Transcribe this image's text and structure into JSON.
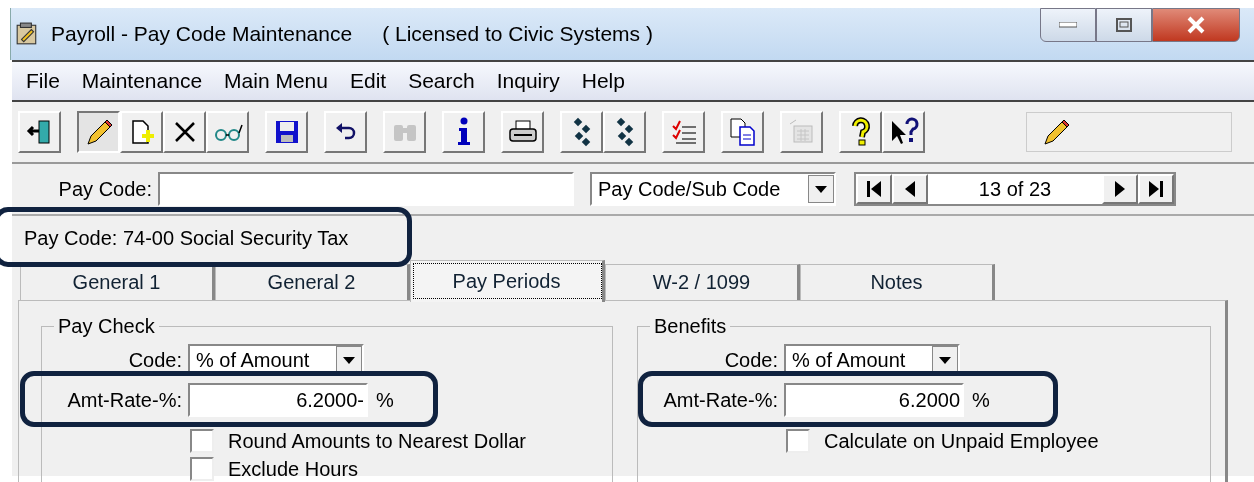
{
  "window": {
    "title": "Payroll - Pay Code Maintenance",
    "license": "( Licensed to Civic Systems )"
  },
  "menu": [
    "File",
    "Maintenance",
    "Main Menu",
    "Edit",
    "Search",
    "Inquiry",
    "Help"
  ],
  "toolbar": [
    [
      {
        "kind": "exit",
        "pressed": false,
        "disabled": false
      }
    ],
    [
      {
        "kind": "edit",
        "pressed": true,
        "disabled": false
      },
      {
        "kind": "new",
        "pressed": false,
        "disabled": false
      },
      {
        "kind": "delete",
        "pressed": false,
        "disabled": false
      },
      {
        "kind": "view",
        "pressed": false,
        "disabled": false
      }
    ],
    [
      {
        "kind": "save",
        "pressed": false,
        "disabled": false
      }
    ],
    [
      {
        "kind": "undo",
        "pressed": false,
        "disabled": false
      }
    ],
    [
      {
        "kind": "find",
        "pressed": false,
        "disabled": true
      }
    ],
    [
      {
        "kind": "info",
        "pressed": false,
        "disabled": false
      }
    ],
    [
      {
        "kind": "print",
        "pressed": false,
        "disabled": false
      }
    ],
    [
      {
        "kind": "dots",
        "pressed": false,
        "disabled": false
      },
      {
        "kind": "dots",
        "pressed": false,
        "disabled": false
      }
    ],
    [
      {
        "kind": "checklist",
        "pressed": false,
        "disabled": false
      }
    ],
    [
      {
        "kind": "copy",
        "pressed": false,
        "disabled": false
      }
    ],
    [
      {
        "kind": "calc",
        "pressed": false,
        "disabled": true
      }
    ],
    [
      {
        "kind": "help",
        "pressed": false,
        "disabled": false
      },
      {
        "kind": "whatsthis",
        "pressed": false,
        "disabled": false
      }
    ]
  ],
  "mode_indicator": {
    "kind": "edit"
  },
  "lookup": {
    "label": "Pay Code:",
    "sort": "Pay Code/Sub Code",
    "record": "13 of 23"
  },
  "current": "Pay Code: 74-00  Social Security Tax",
  "tabs": [
    {
      "label": "General 1",
      "selected": false
    },
    {
      "label": "General 2",
      "selected": false
    },
    {
      "label": "Pay Periods",
      "selected": true
    },
    {
      "label": "W-2 / 1099",
      "selected": false
    },
    {
      "label": "Notes",
      "selected": false
    }
  ],
  "groups": [
    {
      "title": "Pay Check",
      "code_label": "Code:",
      "code": "% of Amount",
      "rate_label": "Amt-Rate-%:",
      "rate": "6.2000-",
      "unit": "%",
      "options": [
        {
          "label": "Round Amounts to Nearest Dollar",
          "checked": false
        },
        {
          "label": "Exclude Hours",
          "checked": false
        }
      ]
    },
    {
      "title": "Benefits",
      "code_label": "Code:",
      "code": "% of Amount",
      "rate_label": "Amt-Rate-%:",
      "rate": "6.2000",
      "unit": "%",
      "options": [
        {
          "label": "Calculate on Unpaid Employee",
          "checked": false
        }
      ]
    }
  ]
}
